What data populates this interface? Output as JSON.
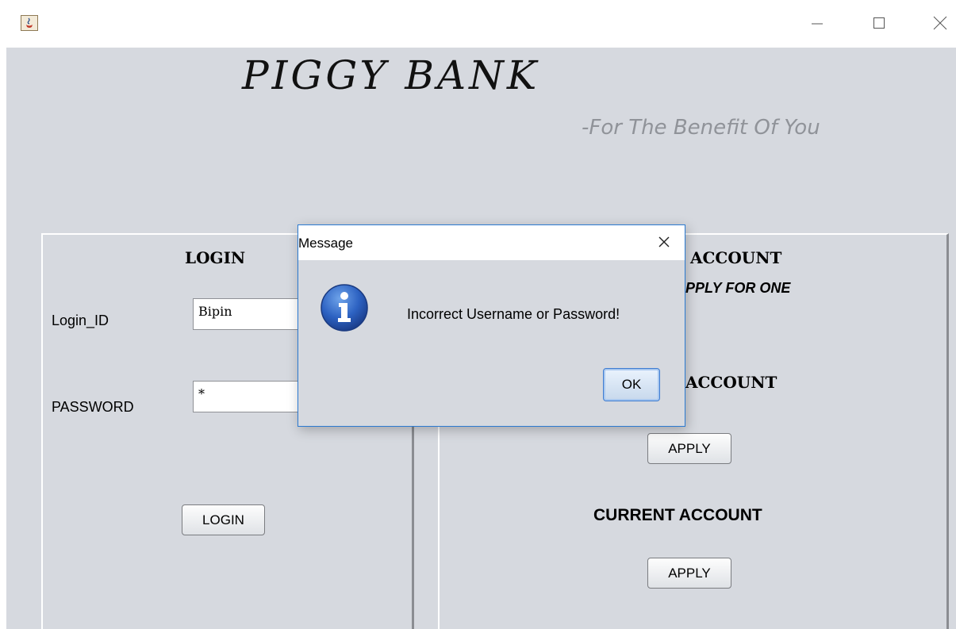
{
  "window": {
    "title_icon": "java-cup-icon",
    "controls": {
      "minimize": "minimize-icon",
      "maximize": "maximize-icon",
      "close": "close-icon"
    }
  },
  "app": {
    "title": "PIGGY BANK",
    "tagline": "-For The Benefit Of You"
  },
  "login_panel": {
    "heading": "LOGIN",
    "login_id_label": "Login_ID",
    "login_id_value": "Bipin",
    "password_label": "PASSWORD",
    "password_value": "*",
    "login_button": "LOGIN"
  },
  "account_panel": {
    "heading_visible": "ACCOUNT",
    "subheading_visible": "PPLY FOR ONE",
    "savings_heading_visible": "ACCOUNT",
    "savings_apply_button": "APPLY",
    "current_heading": "CURRENT ACCOUNT",
    "current_apply_button": "APPLY"
  },
  "dialog": {
    "title": "Message",
    "icon": "information-icon",
    "message": "Incorrect Username or Password!",
    "ok_button": "OK"
  }
}
